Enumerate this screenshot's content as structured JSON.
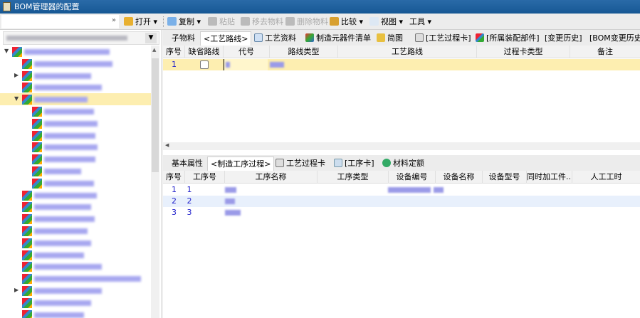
{
  "window": {
    "title": "BOM管理器的配置"
  },
  "toolbar": {
    "open": "打开",
    "copy": "复制",
    "paste": "粘贴",
    "remove": "移去物料",
    "delete": "删除物料",
    "compare": "比较",
    "view": "视图",
    "tools": "工具"
  },
  "upper_tabs": [
    "子物料",
    "<工艺路线>",
    "工艺资料",
    "制造元器件清单",
    "简图",
    "[工艺过程卡]",
    "[所属装配部件]",
    "[变更历史]",
    "[BOM变更历史]"
  ],
  "upper_grid": {
    "columns": [
      "序号",
      "缺省路线",
      "代号",
      "路线类型",
      "工艺路线",
      "过程卡类型",
      "备注"
    ],
    "rows": [
      {
        "seq": "1",
        "default": false
      }
    ]
  },
  "lower_tabs": [
    "基本属性",
    "<制造工序过程>",
    "工艺过程卡",
    "[工序卡]",
    "材料定额"
  ],
  "lower_grid": {
    "columns": [
      "序号",
      "工序号",
      "工序名称",
      "工序类型",
      "设备编号",
      "设备名称",
      "设备型号",
      "同时加工件...",
      "人工工时"
    ],
    "rows": [
      {
        "seq": "1",
        "op": "1"
      },
      {
        "seq": "2",
        "op": "2"
      },
      {
        "seq": "3",
        "op": "3"
      }
    ]
  },
  "colors": {
    "titlebar": "#175894",
    "selection": "#fdeeb0",
    "link": "#2222cc"
  }
}
